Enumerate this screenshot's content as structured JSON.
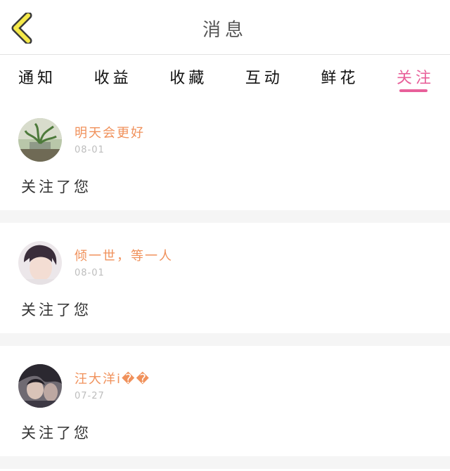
{
  "header": {
    "title": "消息",
    "back_icon": "chevron-left-icon"
  },
  "tabs": [
    {
      "label": "通知",
      "active": false
    },
    {
      "label": "收益",
      "active": false
    },
    {
      "label": "收藏",
      "active": false
    },
    {
      "label": "互动",
      "active": false
    },
    {
      "label": "鲜花",
      "active": false
    },
    {
      "label": "关注",
      "active": true
    }
  ],
  "notifications": [
    {
      "username": "明天会更好",
      "date": "08-01",
      "message": "关注了您"
    },
    {
      "username": "倾一世，等一人",
      "date": "08-01",
      "message": "关注了您"
    },
    {
      "username": "汪大洋i��",
      "date": "07-27",
      "message": "关注了您"
    }
  ],
  "colors": {
    "accent": "#e8609a",
    "username": "#f0915b",
    "back_icon_fill": "#f5e94a"
  }
}
